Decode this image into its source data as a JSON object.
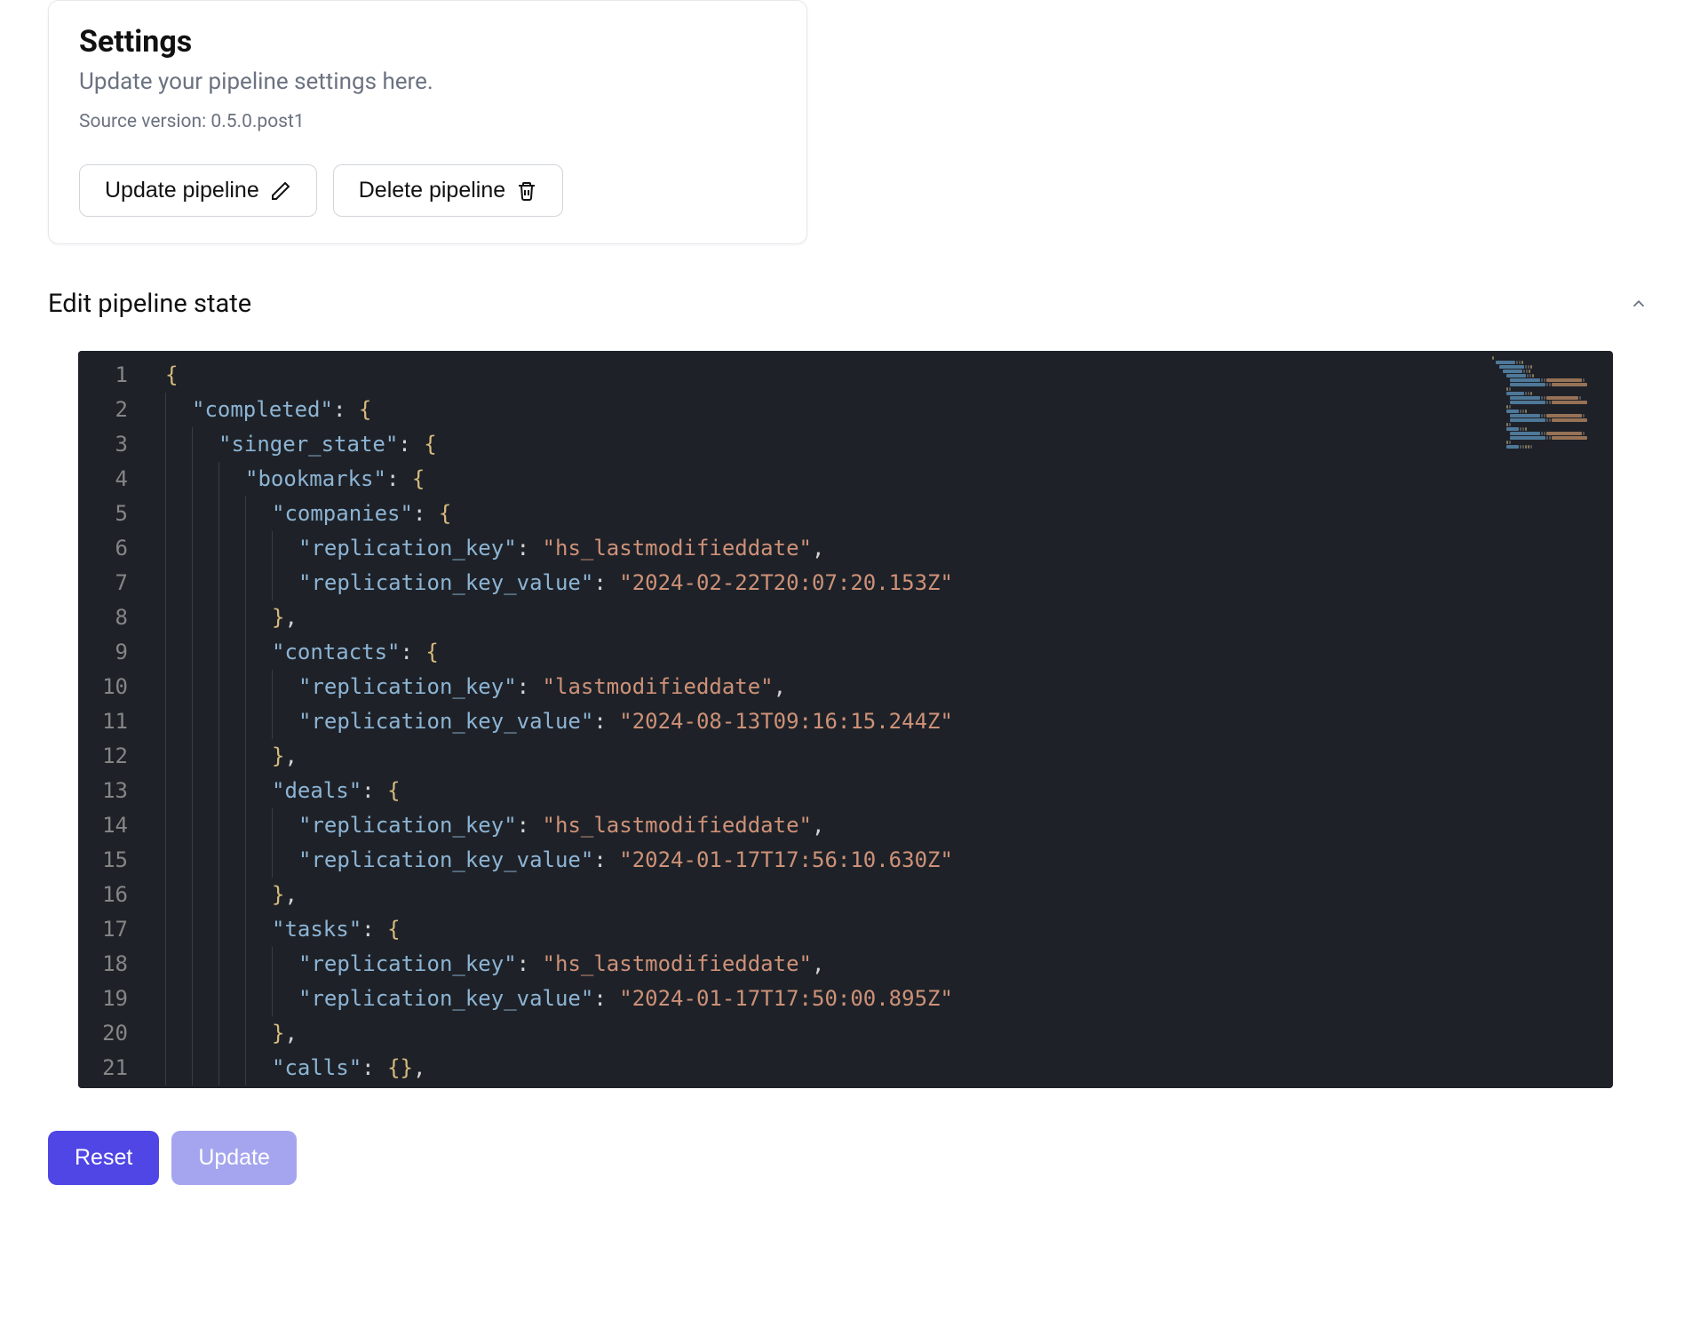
{
  "settings": {
    "title": "Settings",
    "subtitle": "Update your pipeline settings here.",
    "source_version_label": "Source version: ",
    "source_version": "0.5.0.post1",
    "update_pipeline_label": "Update pipeline",
    "delete_pipeline_label": "Delete pipeline"
  },
  "editor_section": {
    "title": "Edit pipeline state"
  },
  "editor": {
    "lines": [
      {
        "indent": 0,
        "tokens": [
          {
            "t": "brace",
            "v": "{"
          }
        ]
      },
      {
        "indent": 1,
        "tokens": [
          {
            "t": "key",
            "v": "\"completed\""
          },
          {
            "t": "colon",
            "v": ":"
          },
          {
            "t": "space",
            "v": " "
          },
          {
            "t": "brace",
            "v": "{"
          }
        ]
      },
      {
        "indent": 2,
        "tokens": [
          {
            "t": "key",
            "v": "\"singer_state\""
          },
          {
            "t": "colon",
            "v": ":"
          },
          {
            "t": "space",
            "v": " "
          },
          {
            "t": "brace",
            "v": "{"
          }
        ]
      },
      {
        "indent": 3,
        "tokens": [
          {
            "t": "key",
            "v": "\"bookmarks\""
          },
          {
            "t": "colon",
            "v": ":"
          },
          {
            "t": "space",
            "v": " "
          },
          {
            "t": "brace",
            "v": "{"
          }
        ]
      },
      {
        "indent": 4,
        "tokens": [
          {
            "t": "key",
            "v": "\"companies\""
          },
          {
            "t": "colon",
            "v": ":"
          },
          {
            "t": "space",
            "v": " "
          },
          {
            "t": "brace",
            "v": "{"
          }
        ]
      },
      {
        "indent": 5,
        "tokens": [
          {
            "t": "key",
            "v": "\"replication_key\""
          },
          {
            "t": "colon",
            "v": ":"
          },
          {
            "t": "space",
            "v": " "
          },
          {
            "t": "string",
            "v": "\"hs_lastmodifieddate\""
          },
          {
            "t": "punc",
            "v": ","
          }
        ]
      },
      {
        "indent": 5,
        "tokens": [
          {
            "t": "key",
            "v": "\"replication_key_value\""
          },
          {
            "t": "colon",
            "v": ":"
          },
          {
            "t": "space",
            "v": " "
          },
          {
            "t": "string",
            "v": "\"2024-02-22T20:07:20.153Z\""
          }
        ]
      },
      {
        "indent": 4,
        "tokens": [
          {
            "t": "brace",
            "v": "}"
          },
          {
            "t": "punc",
            "v": ","
          }
        ]
      },
      {
        "indent": 4,
        "tokens": [
          {
            "t": "key",
            "v": "\"contacts\""
          },
          {
            "t": "colon",
            "v": ":"
          },
          {
            "t": "space",
            "v": " "
          },
          {
            "t": "brace",
            "v": "{"
          }
        ]
      },
      {
        "indent": 5,
        "tokens": [
          {
            "t": "key",
            "v": "\"replication_key\""
          },
          {
            "t": "colon",
            "v": ":"
          },
          {
            "t": "space",
            "v": " "
          },
          {
            "t": "string",
            "v": "\"lastmodifieddate\""
          },
          {
            "t": "punc",
            "v": ","
          }
        ]
      },
      {
        "indent": 5,
        "tokens": [
          {
            "t": "key",
            "v": "\"replication_key_value\""
          },
          {
            "t": "colon",
            "v": ":"
          },
          {
            "t": "space",
            "v": " "
          },
          {
            "t": "string",
            "v": "\"2024-08-13T09:16:15.244Z\""
          }
        ]
      },
      {
        "indent": 4,
        "tokens": [
          {
            "t": "brace",
            "v": "}"
          },
          {
            "t": "punc",
            "v": ","
          }
        ]
      },
      {
        "indent": 4,
        "tokens": [
          {
            "t": "key",
            "v": "\"deals\""
          },
          {
            "t": "colon",
            "v": ":"
          },
          {
            "t": "space",
            "v": " "
          },
          {
            "t": "brace",
            "v": "{"
          }
        ]
      },
      {
        "indent": 5,
        "tokens": [
          {
            "t": "key",
            "v": "\"replication_key\""
          },
          {
            "t": "colon",
            "v": ":"
          },
          {
            "t": "space",
            "v": " "
          },
          {
            "t": "string",
            "v": "\"hs_lastmodifieddate\""
          },
          {
            "t": "punc",
            "v": ","
          }
        ]
      },
      {
        "indent": 5,
        "tokens": [
          {
            "t": "key",
            "v": "\"replication_key_value\""
          },
          {
            "t": "colon",
            "v": ":"
          },
          {
            "t": "space",
            "v": " "
          },
          {
            "t": "string",
            "v": "\"2024-01-17T17:56:10.630Z\""
          }
        ]
      },
      {
        "indent": 4,
        "tokens": [
          {
            "t": "brace",
            "v": "}"
          },
          {
            "t": "punc",
            "v": ","
          }
        ]
      },
      {
        "indent": 4,
        "tokens": [
          {
            "t": "key",
            "v": "\"tasks\""
          },
          {
            "t": "colon",
            "v": ":"
          },
          {
            "t": "space",
            "v": " "
          },
          {
            "t": "brace",
            "v": "{"
          }
        ]
      },
      {
        "indent": 5,
        "tokens": [
          {
            "t": "key",
            "v": "\"replication_key\""
          },
          {
            "t": "colon",
            "v": ":"
          },
          {
            "t": "space",
            "v": " "
          },
          {
            "t": "string",
            "v": "\"hs_lastmodifieddate\""
          },
          {
            "t": "punc",
            "v": ","
          }
        ]
      },
      {
        "indent": 5,
        "tokens": [
          {
            "t": "key",
            "v": "\"replication_key_value\""
          },
          {
            "t": "colon",
            "v": ":"
          },
          {
            "t": "space",
            "v": " "
          },
          {
            "t": "string",
            "v": "\"2024-01-17T17:50:00.895Z\""
          }
        ]
      },
      {
        "indent": 4,
        "tokens": [
          {
            "t": "brace",
            "v": "}"
          },
          {
            "t": "punc",
            "v": ","
          }
        ]
      },
      {
        "indent": 4,
        "tokens": [
          {
            "t": "key",
            "v": "\"calls\""
          },
          {
            "t": "colon",
            "v": ":"
          },
          {
            "t": "space",
            "v": " "
          },
          {
            "t": "brace",
            "v": "{"
          },
          {
            "t": "brace",
            "v": "}"
          },
          {
            "t": "punc",
            "v": ","
          }
        ]
      }
    ]
  },
  "actions": {
    "reset_label": "Reset",
    "update_label": "Update"
  }
}
